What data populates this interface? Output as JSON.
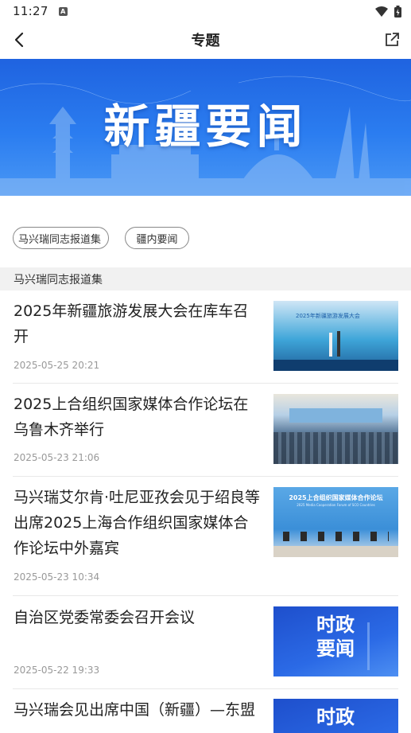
{
  "status": {
    "time": "11:27",
    "notif_letter": "A"
  },
  "header": {
    "title": "专题"
  },
  "banner": {
    "title": "新疆要闻"
  },
  "tags": [
    {
      "label": "马兴瑞同志报道集"
    },
    {
      "label": "疆内要闻"
    }
  ],
  "section": {
    "title": "马兴瑞同志报道集"
  },
  "news": [
    {
      "title": "2025年新疆旅游发展大会在库车召开",
      "date": "2025-05-25 20:21",
      "thumb_caption": "2025年新疆旅游发展大会"
    },
    {
      "title": "2025上合组织国家媒体合作论坛在乌鲁木齐举行",
      "date": "2025-05-23 21:06"
    },
    {
      "title": "马兴瑞艾尔肯·吐尼亚孜会见于绍良等出席2025上海合作组织国家媒体合作论坛中外嘉宾",
      "date": "2025-05-23 10:34",
      "thumb_caption": "2025上合组织国家媒体合作论坛",
      "thumb_sub": "2025 Media Cooperation Forum of SCO Countries"
    },
    {
      "title": "自治区党委常委会召开会议",
      "date": "2025-05-22 19:33",
      "thumb_caption": "时政要闻"
    },
    {
      "title": "马兴瑞会见出席中国（新疆）—东盟",
      "thumb_caption": "时政"
    }
  ],
  "colors": {
    "banner": "#2b7df0",
    "date": "#999999",
    "section_bg": "#f1f1f1"
  }
}
